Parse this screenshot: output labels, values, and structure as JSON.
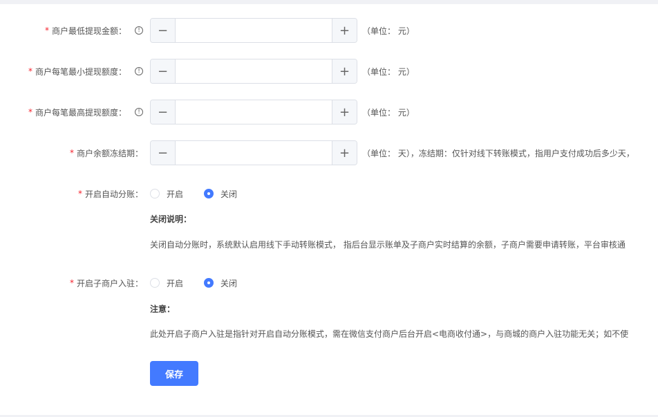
{
  "fields": [
    {
      "label": "商户最低提现金额：",
      "info": true,
      "value": "",
      "unit": "（单位： 元）"
    },
    {
      "label": "商户每笔最小提现额度：",
      "info": true,
      "value": "",
      "unit": "（单位： 元）"
    },
    {
      "label": "商户每笔最高提现额度：",
      "info": true,
      "value": "",
      "unit": "（单位： 元）"
    },
    {
      "label": "商户余额冻结期：",
      "info": false,
      "value": "",
      "unit": "（单位： 天），冻结期：仅针对线下转账模式，指用户支付成功后多少天，"
    }
  ],
  "required_mark": "*",
  "info_icon": "ⓘ",
  "minus": "−",
  "plus": "+",
  "auto_split": {
    "label": "开启自动分账：",
    "options": [
      "开启",
      "关闭"
    ],
    "selected": "关闭",
    "note_title": "关闭说明：",
    "note_text": "关闭自动分账时，系统默认启用线下手动转账模式， 指后台显示账单及子商户实时结算的余额，子商户需要申请转账，平台审核通"
  },
  "sub_merchant": {
    "label": "开启子商户入驻：",
    "options": [
      "开启",
      "关闭"
    ],
    "selected": "关闭",
    "note_title": "注意：",
    "note_text": "此处开启子商户入驻是指针对开启自动分账模式，需在微信支付商户后台开启<电商收付通>，与商城的商户入驻功能无关；如不使"
  },
  "save_label": "保存",
  "colors": {
    "primary": "#437aff",
    "required": "#f5222d"
  }
}
